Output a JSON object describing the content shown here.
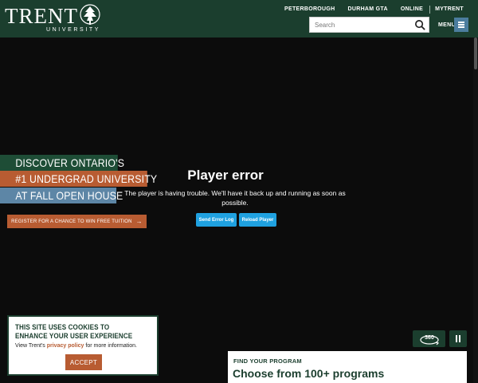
{
  "header": {
    "logo_word": "TRENT",
    "logo_sub": "UNIVERSITY",
    "topnav": [
      "PETERBOROUGH",
      "DURHAM GTA",
      "ONLINE",
      "MYTRENT"
    ],
    "search_placeholder": "Search",
    "menu_label": "MENU",
    "background_color": "#1b3e2e"
  },
  "hero": {
    "lines": [
      "DISCOVER ONTARIO'S",
      "#1 UNDERGRAD UNIVERSITY",
      "AT FALL OPEN HOUSE"
    ],
    "line_colors": [
      "#1e4d36",
      "#b85c32",
      "#5d86a6"
    ],
    "register_label": "REGISTER FOR A CHANCE TO WIN FREE TUITION"
  },
  "player": {
    "title": "Player error",
    "message": "The player is having trouble. We'll have it back up and running as soon as possible.",
    "send_log_label": "Send Error Log",
    "reload_label": "Reload Player",
    "button_color": "#1fa1e0",
    "view_label": "360"
  },
  "cookie": {
    "title": "THIS SITE USES COOKIES TO ENHANCE YOUR USER EXPERIENCE",
    "text_before": "View Trent's ",
    "link_text": "privacy policy",
    "text_after": " for more information.",
    "accept_label": "ACCEPT"
  },
  "program": {
    "label": "FIND YOUR PROGRAM",
    "title": "Choose from 100+ programs"
  }
}
